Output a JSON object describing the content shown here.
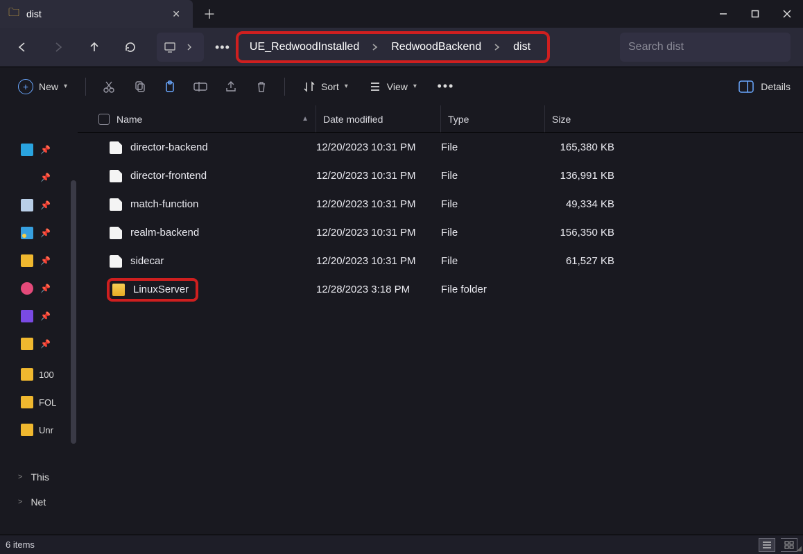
{
  "tab": {
    "title": "dist"
  },
  "breadcrumbs": [
    "UE_RedwoodInstalled",
    "RedwoodBackend",
    "dist"
  ],
  "search": {
    "placeholder": "Search dist"
  },
  "toolbar": {
    "new_label": "New",
    "sort_label": "Sort",
    "view_label": "View",
    "details_label": "Details"
  },
  "columns": {
    "name": "Name",
    "date": "Date modified",
    "type": "Type",
    "size": "Size"
  },
  "files": [
    {
      "name": "director-backend",
      "date": "12/20/2023 10:31 PM",
      "type": "File",
      "size": "165,380 KB",
      "kind": "file"
    },
    {
      "name": "director-frontend",
      "date": "12/20/2023 10:31 PM",
      "type": "File",
      "size": "136,991 KB",
      "kind": "file"
    },
    {
      "name": "match-function",
      "date": "12/20/2023 10:31 PM",
      "type": "File",
      "size": "49,334 KB",
      "kind": "file"
    },
    {
      "name": "realm-backend",
      "date": "12/20/2023 10:31 PM",
      "type": "File",
      "size": "156,350 KB",
      "kind": "file"
    },
    {
      "name": "sidecar",
      "date": "12/20/2023 10:31 PM",
      "type": "File",
      "size": "61,527 KB",
      "kind": "file"
    },
    {
      "name": "LinuxServer",
      "date": "12/28/2023 3:18 PM",
      "type": "File folder",
      "size": "",
      "kind": "folder",
      "highlight": true
    }
  ],
  "sidebar": {
    "quick": [
      {
        "label": "",
        "icon": "desktop"
      },
      {
        "label": "",
        "icon": "dl"
      },
      {
        "label": "",
        "icon": "doc"
      },
      {
        "label": "",
        "icon": "pic"
      },
      {
        "label": "",
        "icon": "folder"
      },
      {
        "label": "",
        "icon": "music"
      },
      {
        "label": "",
        "icon": "video"
      },
      {
        "label": "",
        "icon": "folder"
      }
    ],
    "folders": [
      "100",
      "FOL",
      "Unr"
    ],
    "tree": [
      {
        "label": "This",
        "icon": "pc",
        "chev": ">"
      },
      {
        "label": "Net",
        "icon": "net",
        "chev": ">"
      }
    ]
  },
  "status": {
    "count": "6 items"
  }
}
